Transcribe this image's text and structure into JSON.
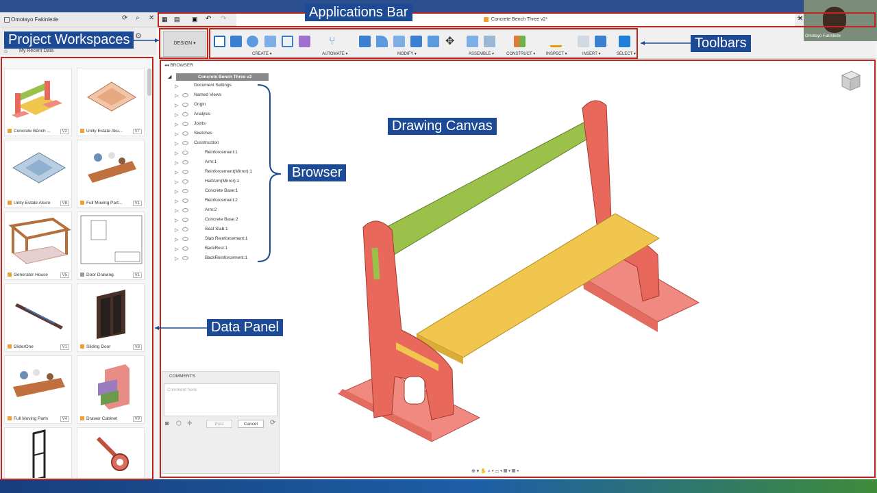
{
  "user": {
    "name": "Omotayo Fakinlede",
    "webcam_label": "Omotayo Fakinlede"
  },
  "breadcrumb": "My Recent Data",
  "document_tab": "Concrete Bench Three v2*",
  "workspace": "DESIGN",
  "toolbar_groups": [
    {
      "label": "CREATE"
    },
    {
      "label": "AUTOMATE"
    },
    {
      "label": "MODIFY"
    },
    {
      "label": "ASSEMBLE"
    },
    {
      "label": "CONSTRUCT"
    },
    {
      "label": "INSPECT"
    },
    {
      "label": "INSERT"
    },
    {
      "label": "SELECT"
    }
  ],
  "browser": {
    "title": "BROWSER",
    "root": "Concrete Bench Three v2",
    "items": [
      "Document Settings",
      "Named Views",
      "Origin",
      "Analysis",
      "Joints",
      "Sketches",
      "Construction",
      "Reinforcement:1",
      "Arm:1",
      "Reinforcement(Mirror):1",
      "HalfArm(Mirror):1",
      "Concrete Base:1",
      "Reinforcement:2",
      "Arm:2",
      "Concrete Base:2",
      "Seat Slab:1",
      "Slab Reinforcement:1",
      "BackRest:1",
      "BackReinforcement:1"
    ]
  },
  "data_panel": {
    "items": [
      {
        "name": "Concrete Bench ...",
        "version": "V2"
      },
      {
        "name": "Unity Estate Aku...",
        "version": "V7"
      },
      {
        "name": "Unity Estate Akure",
        "version": "V8"
      },
      {
        "name": "Full Moving Part...",
        "version": "V1"
      },
      {
        "name": "Generator House",
        "version": "V5"
      },
      {
        "name": "Door Drawing",
        "version": "V1"
      },
      {
        "name": "SliderOne",
        "version": "V1"
      },
      {
        "name": "Sliding Door",
        "version": "V8"
      },
      {
        "name": "Full Moving Parts",
        "version": "V4"
      },
      {
        "name": "Drawer Cabinet",
        "version": "V9"
      }
    ]
  },
  "comments": {
    "title": "COMMENTS",
    "placeholder": "Comment here.",
    "post": "Post",
    "cancel": "Cancel"
  },
  "annotations": {
    "applications_bar": "Applications Bar",
    "project_workspaces": "Project Workspaces",
    "toolbars": "Toolbars",
    "drawing_canvas": "Drawing Canvas",
    "browser": "Browser",
    "data_panel": "Data Panel"
  },
  "colors": {
    "annotation_bg": "#1d4a95",
    "outline_red": "#c0251d",
    "bench_frame": "#e8685c",
    "bench_back": "#9bc14a",
    "bench_seat": "#f0c64f",
    "bench_base": "#f08a80"
  }
}
